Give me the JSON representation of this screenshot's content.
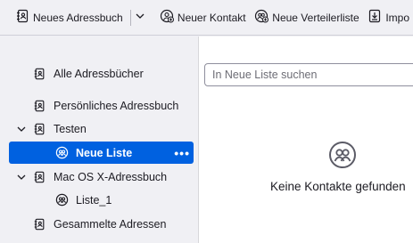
{
  "toolbar": {
    "new_addressbook": {
      "label": "Neues Adressbuch",
      "icon": "address-book-icon"
    },
    "dropdown": {
      "icon": "chevron-down-icon"
    },
    "new_contact": {
      "label": "Neuer Kontakt",
      "icon": "add-contact-icon"
    },
    "new_list": {
      "label": "Neue Verteilerliste",
      "icon": "add-list-icon"
    },
    "import": {
      "label": "Impo",
      "icon": "import-icon"
    }
  },
  "sidebar": {
    "items": [
      {
        "label": "Alle Adressbücher",
        "icon": "address-book-icon"
      },
      {
        "label": "Persönliches Adressbuch",
        "icon": "address-book-icon"
      },
      {
        "label": "Testen",
        "icon": "address-book-icon",
        "expanded": true
      },
      {
        "label": "Neue Liste",
        "icon": "mailing-list-icon",
        "selected": true,
        "more": "•••"
      },
      {
        "label": "Mac OS X-Adressbuch",
        "icon": "address-book-icon",
        "expanded": true
      },
      {
        "label": "Liste_1",
        "icon": "mailing-list-icon"
      },
      {
        "label": "Gesammelte Adressen",
        "icon": "address-book-icon"
      }
    ]
  },
  "main": {
    "search_placeholder": "In Neue Liste suchen",
    "search_value": "",
    "empty_text": "Keine Kontakte gefunden",
    "empty_icon": "contacts-group-icon"
  },
  "colors": {
    "accent": "#0061e0",
    "sidebar_bg": "#f0f0f4",
    "main_bg": "#ffffff"
  }
}
